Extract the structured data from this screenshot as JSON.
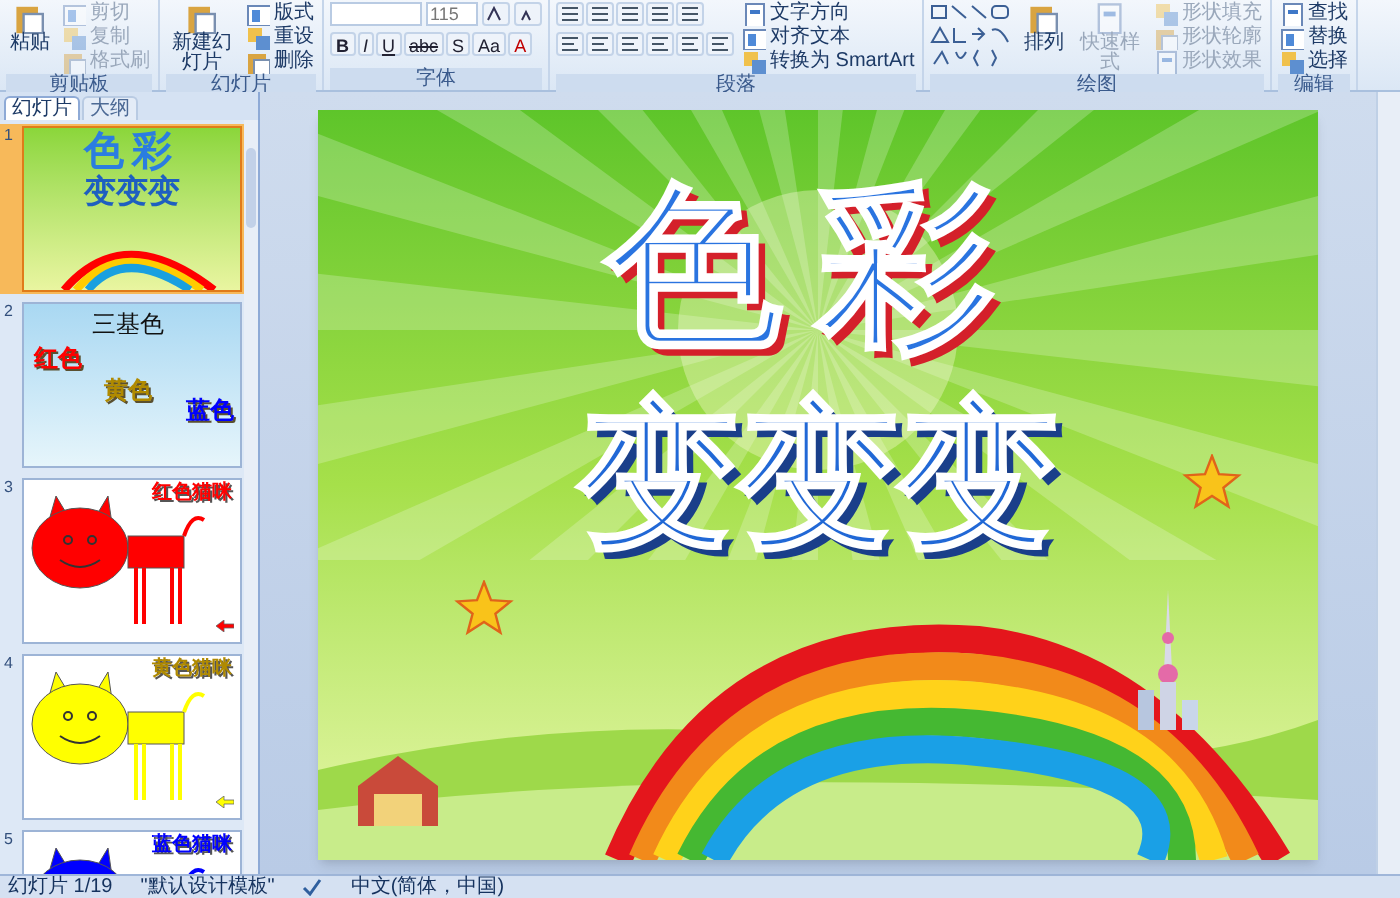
{
  "ribbon": [
    {
      "kind": "buttons",
      "label": "剪贴板",
      "buttons": [
        {
          "kind": "large",
          "label": "粘贴",
          "disabled": false
        },
        {
          "kind": "small",
          "label": "剪切",
          "disabled": true
        },
        {
          "kind": "small",
          "label": "复制",
          "disabled": true
        },
        {
          "kind": "small",
          "label": "格式刷",
          "disabled": true
        }
      ]
    },
    {
      "kind": "buttons",
      "label": "幻灯片",
      "buttons": [
        {
          "kind": "large",
          "label": "新建幻灯片",
          "disabled": false
        },
        {
          "kind": "small",
          "label": "版式",
          "disabled": false
        },
        {
          "kind": "small",
          "label": "重设",
          "disabled": false
        },
        {
          "kind": "small",
          "label": "删除",
          "disabled": false
        }
      ]
    },
    {
      "kind": "font",
      "label": "字体",
      "size": "115",
      "format_buttons": [
        "B",
        "I",
        "U",
        "abc",
        "S",
        "Aa",
        "A"
      ]
    },
    {
      "kind": "paragraph",
      "label": "段落",
      "buttons": [
        {
          "kind": "small",
          "label": "文字方向",
          "disabled": false
        },
        {
          "kind": "small",
          "label": "对齐文本",
          "disabled": false
        },
        {
          "kind": "small",
          "label": "转换为 SmartArt",
          "disabled": false
        }
      ]
    },
    {
      "kind": "drawing",
      "label": "绘图",
      "buttons": [
        {
          "kind": "large",
          "label": "排列",
          "disabled": false
        },
        {
          "kind": "large",
          "label": "快速样式",
          "disabled": true
        },
        {
          "kind": "small",
          "label": "形状填充",
          "disabled": true
        },
        {
          "kind": "small",
          "label": "形状轮廓",
          "disabled": true
        },
        {
          "kind": "small",
          "label": "形状效果",
          "disabled": true
        }
      ]
    },
    {
      "kind": "buttons",
      "label": "编辑",
      "buttons": [
        {
          "kind": "small",
          "label": "查找",
          "disabled": false
        },
        {
          "kind": "small",
          "label": "替换",
          "disabled": false
        },
        {
          "kind": "small",
          "label": "选择",
          "disabled": false
        }
      ]
    }
  ],
  "pane_tabs": [
    {
      "label": "幻灯片",
      "selected": true
    },
    {
      "label": "大纲",
      "selected": false
    }
  ],
  "thumbnails": [
    {
      "number": "1",
      "kind": "title",
      "selected": true,
      "title": "色彩",
      "subtitle": "变变变"
    },
    {
      "number": "2",
      "kind": "primaries",
      "selected": false,
      "title": "三基色",
      "words": [
        {
          "text": "红色",
          "color": "#ff0000"
        },
        {
          "text": "黄色",
          "color": "#b08a00"
        },
        {
          "text": "蓝色",
          "color": "#0000ff"
        }
      ]
    },
    {
      "number": "3",
      "kind": "cat",
      "selected": false,
      "caption": {
        "text": "红色猫咪",
        "color": "#ff0000"
      },
      "color": "#ff0000"
    },
    {
      "number": "4",
      "kind": "cat",
      "selected": false,
      "caption": {
        "text": "黄色猫咪",
        "color": "#b08a00"
      },
      "color": "#ffff00"
    },
    {
      "number": "5",
      "kind": "cat",
      "selected": false,
      "caption": {
        "text": "蓝色猫咪",
        "color": "#0000ff"
      },
      "color": "#0000ff"
    }
  ],
  "slide": {
    "title": "色彩",
    "subtitle": "变变变"
  },
  "status_bar": {
    "slide_counter": "幻灯片 1/19",
    "theme": "\"默认设计模板\"",
    "language": "中文(简体，中国)"
  }
}
